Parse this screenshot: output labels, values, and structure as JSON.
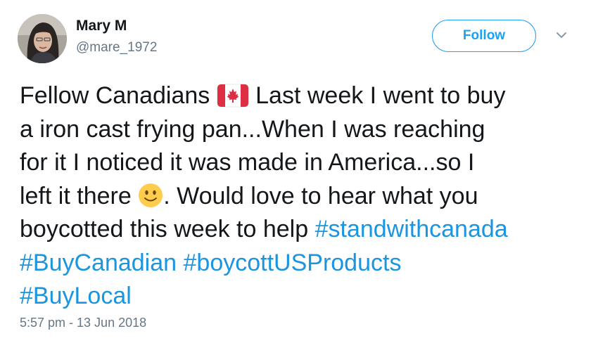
{
  "author": {
    "display_name": "Mary M",
    "handle": "@mare_1972",
    "avatar_icon": "profile-photo"
  },
  "follow_button": {
    "label": "Follow",
    "color": "#1da1f2"
  },
  "menu_icon": "chevron-down-icon",
  "tweet": {
    "lines": [
      {
        "before": "Fellow Canadians ",
        "emoji": "canadian-flag-emoji",
        "after": " Last week I went to buy"
      },
      {
        "text": "a iron cast frying pan...When I was reaching"
      },
      {
        "text": "for it I noticed it was made in America...so I"
      },
      {
        "before": "left it there ",
        "emoji": "slightly-smiling-face-emoji",
        "after": ". Would love to hear what you"
      },
      {
        "before": "boycotted this week to help ",
        "hashtag": "#standwithcanada"
      },
      {
        "hashtags": [
          "#BuyCanadian",
          "#boycottUSProducts"
        ]
      },
      {
        "hashtags": [
          "#BuyLocal"
        ]
      }
    ],
    "hashtag_color": "#1b95e0"
  },
  "timestamp": "5:57 pm - 13 Jun 2018"
}
